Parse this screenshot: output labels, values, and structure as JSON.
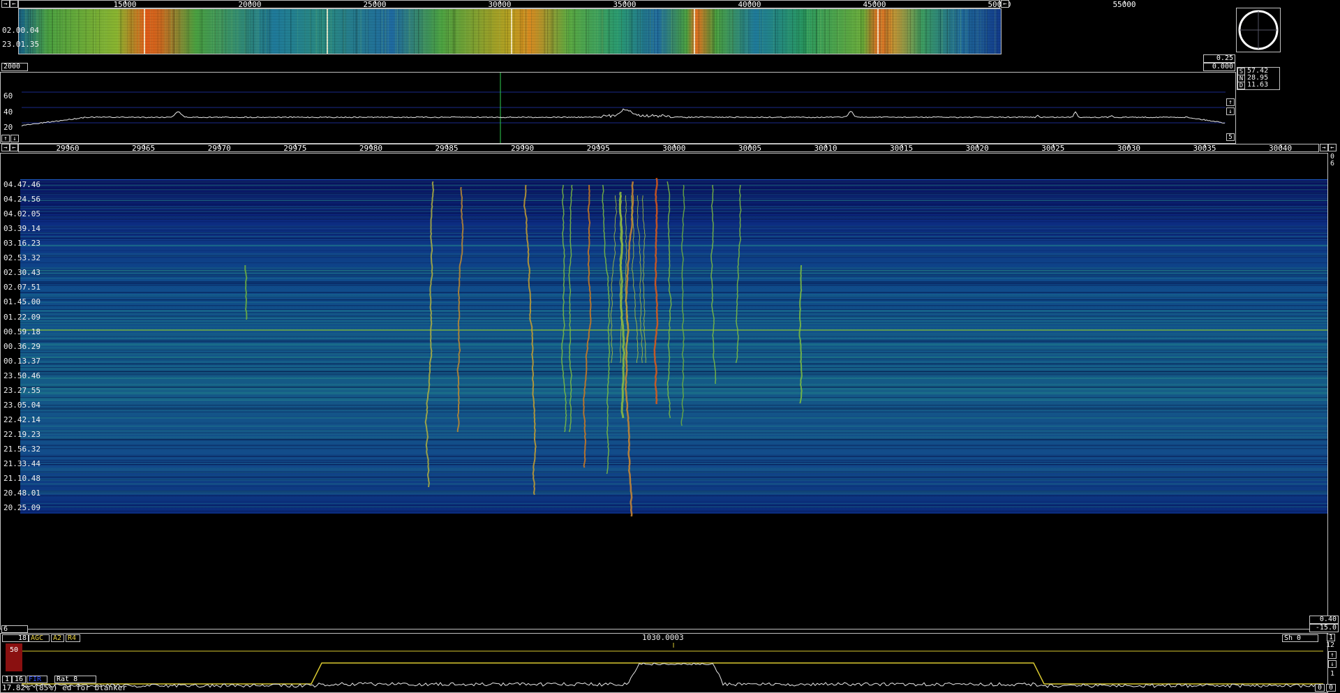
{
  "top_ruler": {
    "ticks": [
      "15000",
      "20000",
      "25000",
      "30000",
      "35000",
      "40000",
      "45000",
      "50000",
      "55000"
    ]
  },
  "wide_waterfall": {
    "times": [
      "02.00.04",
      "23.01.35"
    ]
  },
  "left_val_top": "2000",
  "right_vals_top": [
    "0.25",
    "0.000"
  ],
  "spectrum": {
    "scale_top": "500",
    "y_ticks": [
      "60",
      "40",
      "20"
    ],
    "right_stats": [
      "57.42",
      "28.95",
      "11.63"
    ],
    "right_letters": [
      "S",
      "N",
      "D"
    ],
    "side_button": "5"
  },
  "mid_ruler": {
    "ticks": [
      "29960",
      "29965",
      "29970",
      "29975",
      "29980",
      "29985",
      "29990",
      "29995",
      "30000",
      "30005",
      "30010",
      "30015",
      "30020",
      "30025",
      "30030",
      "30035",
      "30040"
    ]
  },
  "corner_right_top": [
    "0",
    "6"
  ],
  "main_waterfall": {
    "times": [
      "04.47.46",
      "04.24.56",
      "04.02.05",
      "03.39.14",
      "03.16.23",
      "02.53.32",
      "02.30.43",
      "02.07.51",
      "01.45.00",
      "01.22.09",
      "00.59.18",
      "00.36.29",
      "00.13.37",
      "23.50.46",
      "23.27.55",
      "23.05.04",
      "22.42.14",
      "22.19.23",
      "21.56.32",
      "21.33.44",
      "21.10.48",
      "20.48.01",
      "20.25.09"
    ]
  },
  "bottom_left_box": "6",
  "bottom_right_vals": [
    "0.40",
    "-15.0"
  ],
  "baseband": {
    "freq_label": "1030.0003",
    "left_controls": [
      "18",
      "AGC",
      "A2",
      "R4"
    ],
    "level": "50",
    "right_label": "Sh   0",
    "right_numbers": [
      "1",
      "12",
      "1"
    ],
    "bottom_controls": [
      "1",
      "16",
      "FIR",
      "Rat  8"
    ],
    "status_text": "17.82% (85%) ed for blanker",
    "bottom_right_buttons": [
      "0",
      "0"
    ]
  },
  "colors": {
    "waterfall_low": "#0a1a6a",
    "waterfall_mid": "#1f9a8a",
    "waterfall_hi": "#e04a10",
    "trace": "#e8e8e8",
    "grid": "#1a2a8a",
    "filter": "#d8c830"
  }
}
